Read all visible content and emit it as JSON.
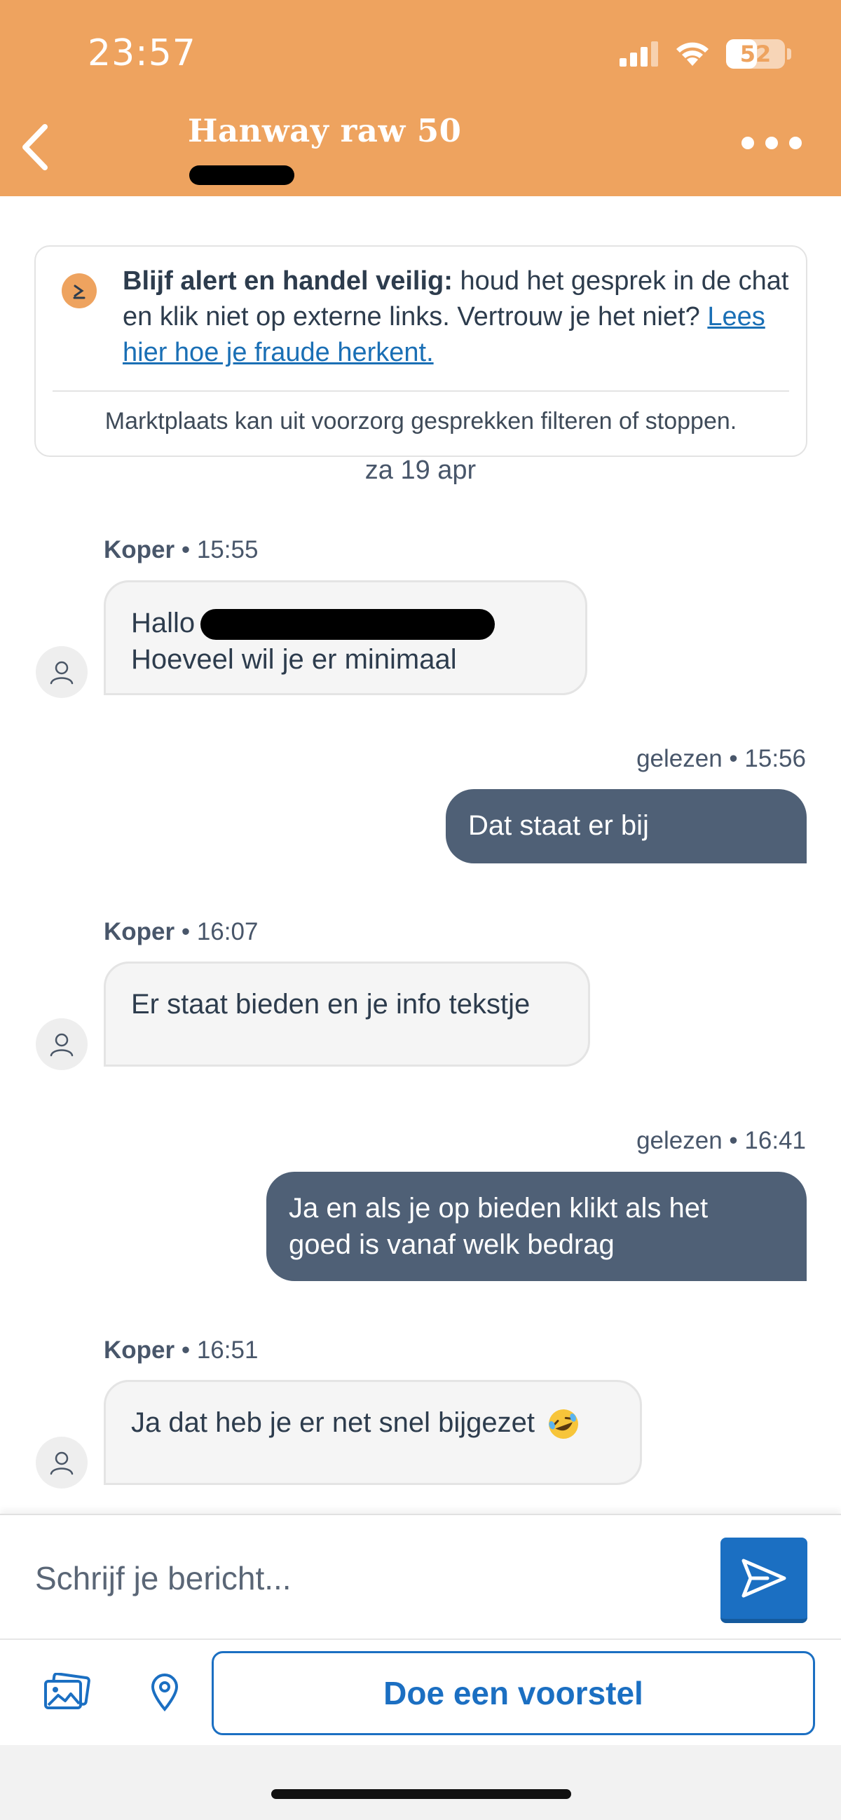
{
  "status_bar": {
    "time": "23:57",
    "battery": "52",
    "battery_level": 0.52,
    "icons": [
      "signal-icon",
      "wifi-icon",
      "battery-icon"
    ]
  },
  "header": {
    "title": "Hanway raw 50",
    "back_icon": "chevron-left-icon",
    "more_icon": "more-dots-icon",
    "background": "#eea35f"
  },
  "banner": {
    "bold": "Blijf alert en handel veilig:",
    "text": " houd het gesprek in de chat en klik niet op externe links. Vertrouw je het niet? ",
    "link": "Lees hier hoe je fraude herkent.",
    "footer": "Marktplaats kan uit voorzorg gesprekken filteren of stoppen."
  },
  "date": "za 19 apr",
  "messages": [
    {
      "dir": "in",
      "sender": "Koper",
      "time": "15:55",
      "line1": "Hallo",
      "line2": "Hoeveel wil je er minimaal"
    },
    {
      "dir": "out",
      "status": "gelezen",
      "time": "15:56",
      "text": "Dat staat er bij"
    },
    {
      "dir": "in",
      "sender": "Koper",
      "time": "16:07",
      "text": "Er staat bieden en je info tekstje"
    },
    {
      "dir": "out",
      "status": "gelezen",
      "time": "16:41",
      "line1": "Ja en als je op bieden klikt als het",
      "line2": "goed is vanaf welk bedrag"
    },
    {
      "dir": "in",
      "sender": "Koper",
      "time": "16:51",
      "text": "Ja dat heb je er net snel bijgezet"
    }
  ],
  "composer": {
    "placeholder": "Schrijf je bericht...",
    "send_icon": "send-icon",
    "image_icon": "image-icon",
    "location_icon": "location-pin-icon",
    "offer_label": "Doe een voorstel",
    "accent": "#1b6fc2"
  },
  "colors": {
    "outgoing_bubble": "#4f6076",
    "incoming_bubble": "#f5f5f5",
    "link": "#1a6fb5"
  }
}
